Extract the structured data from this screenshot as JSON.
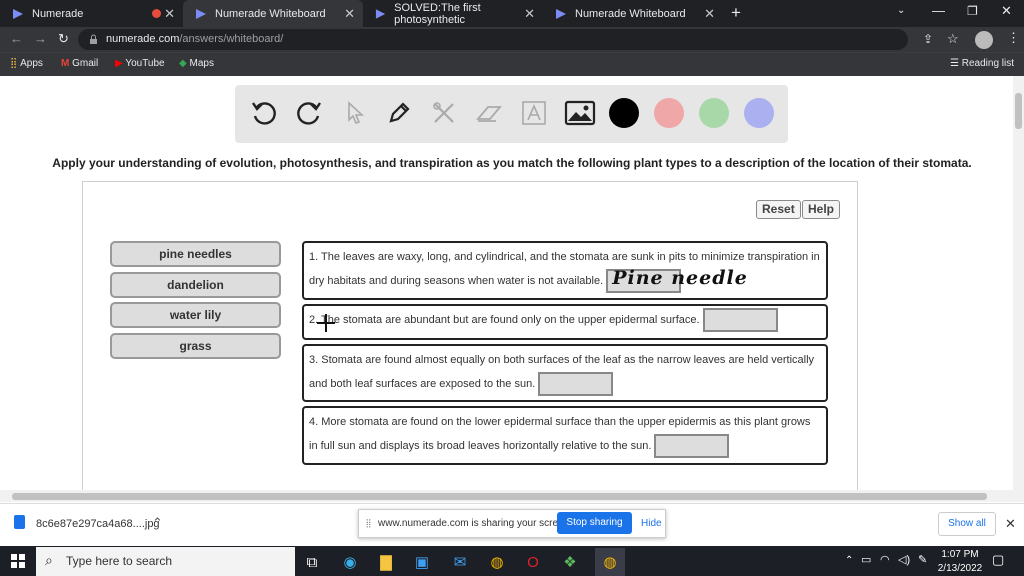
{
  "browser": {
    "tabs": [
      {
        "title": "Numerade"
      },
      {
        "title": "Numerade Whiteboard"
      },
      {
        "title": "SOLVED:The first photosynthetic"
      },
      {
        "title": "Numerade Whiteboard"
      }
    ],
    "url_host": "numerade.com",
    "url_path": "/answers/whiteboard/",
    "bookmarks": [
      "Apps",
      "Gmail",
      "YouTube",
      "Maps"
    ],
    "reading_list": "Reading list"
  },
  "whiteboard": {
    "colors": [
      "#000000",
      "#f0a7a7",
      "#a8d8a8",
      "#aab0f0"
    ]
  },
  "question": {
    "instruction": "Apply your understanding of evolution, photosynthesis, and transpiration as you match the following plant types to a description of the location of their stomata.",
    "reset_label": "Reset",
    "help_label": "Help",
    "options": [
      "pine needles",
      "dandelion",
      "water lily",
      "grass"
    ],
    "items": [
      {
        "text": "1. The leaves are waxy, long, and cylindrical, and the stomata are sunk in pits to minimize transpiration in dry habitats and during seasons when water is not available.",
        "answer_scribble": "Pine needle"
      },
      {
        "text": "2. The stomata are abundant but are found only on the upper epidermal surface."
      },
      {
        "text": "3. Stomata are found almost equally on both surfaces of the leaf as the narrow leaves are held vertically and both leaf surfaces are exposed to the sun."
      },
      {
        "text": "4. More stomata are found on the lower epidermal surface than the upper epidermis as this plant grows in full sun and displays its broad leaves horizontally relative to the sun."
      }
    ]
  },
  "downloads": {
    "file": "8c6e87e297ca4a68....jpg",
    "show_all": "Show all"
  },
  "share_bar": {
    "message": "www.numerade.com is sharing your screen.",
    "stop": "Stop sharing",
    "hide": "Hide"
  },
  "taskbar": {
    "search_placeholder": "Type here to search",
    "time": "1:07 PM",
    "date": "2/13/2022"
  }
}
